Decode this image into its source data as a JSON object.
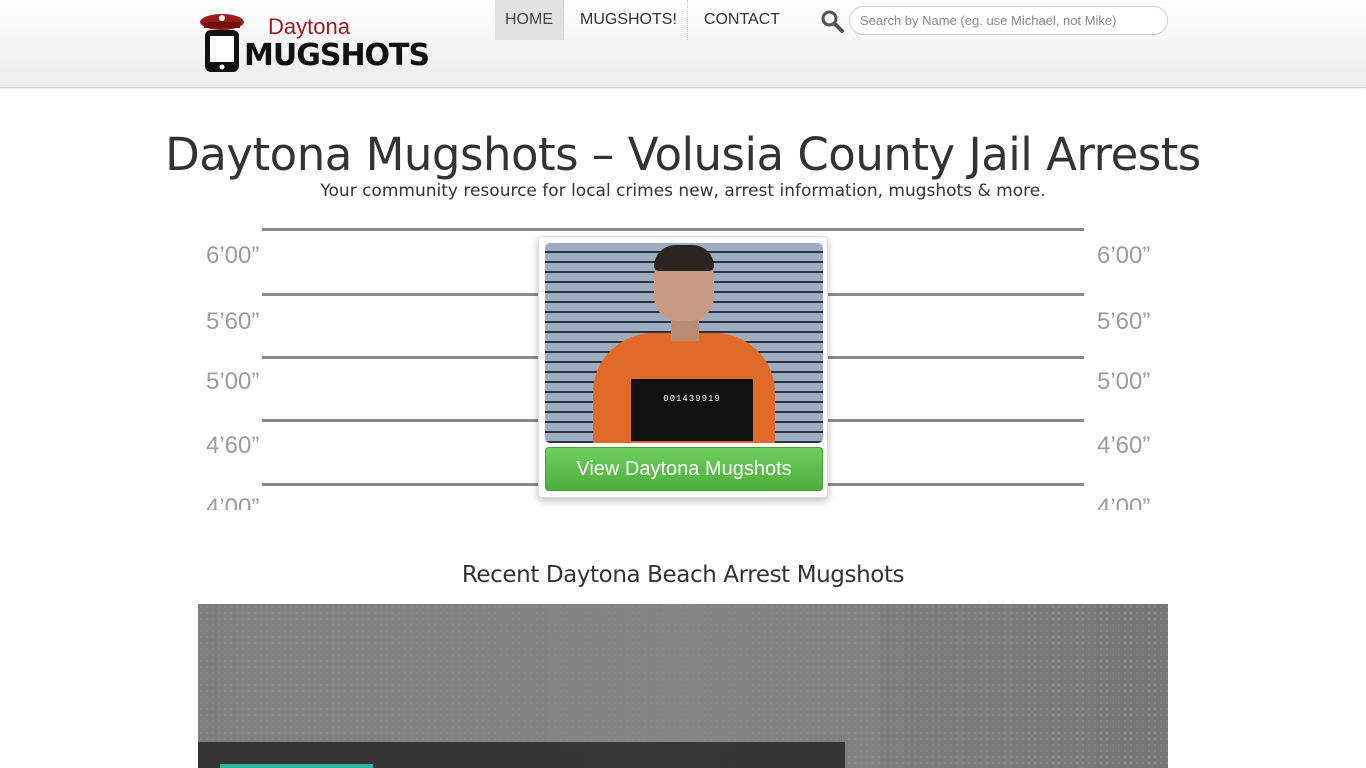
{
  "brand": {
    "city": "Daytona",
    "word": "MUGSHOTS"
  },
  "nav": {
    "items": [
      {
        "label": "HOME",
        "active": true
      },
      {
        "label": "MUGSHOTS!",
        "active": false
      },
      {
        "label": "CONTACT",
        "active": false
      }
    ]
  },
  "search": {
    "icon": "search-icon",
    "placeholder": "Search by Name (eg. use Michael, not Mike)"
  },
  "hero": {
    "title": "Daytona Mugshots – Volusia County Jail Arrests",
    "subtitle": "Your community resource for local crimes new, arrest information, mugshots & more."
  },
  "height_chart": {
    "labels": [
      "6’00”",
      "5’60”",
      "5’00”",
      "4’60”",
      "4’00”"
    ]
  },
  "card": {
    "board_text": "001439919",
    "button_label": "View Daytona Mugshots"
  },
  "recent": {
    "title": "Recent Daytona Beach Arrest Mugshots"
  },
  "colors": {
    "brand_red": "#9b1b1b",
    "button_green": "#5cbf4b",
    "accent_teal": "#2bb5a0"
  }
}
